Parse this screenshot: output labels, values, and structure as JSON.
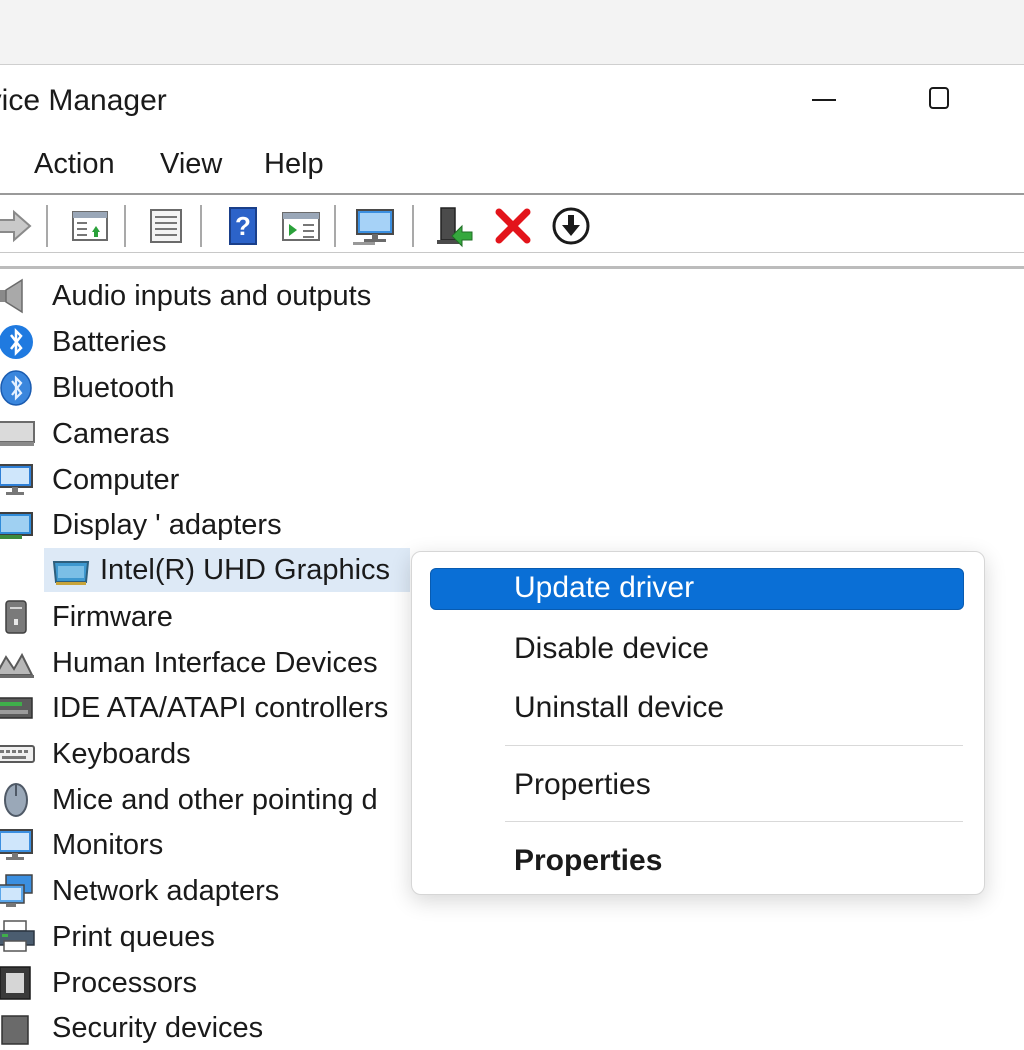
{
  "window": {
    "title": "evice Manager"
  },
  "menubar": {
    "items": [
      {
        "label": "Action"
      },
      {
        "label": "View"
      },
      {
        "label": "Help"
      }
    ]
  },
  "toolbar": {
    "buttons": [
      {
        "icon": "forward-arrow-icon"
      },
      {
        "icon": "properties-pane-icon"
      },
      {
        "icon": "details-list-icon"
      },
      {
        "icon": "help-icon"
      },
      {
        "icon": "show-hidden-icon"
      },
      {
        "icon": "scan-hardware-monitor-icon"
      },
      {
        "icon": "update-driver-icon"
      },
      {
        "icon": "uninstall-x-icon"
      },
      {
        "icon": "disable-device-icon"
      }
    ]
  },
  "tree": {
    "items": [
      {
        "label": "Audio inputs and outputs",
        "icon": "speaker-icon"
      },
      {
        "label": "Batteries",
        "icon": "bluetooth-badge-icon"
      },
      {
        "label": "Bluetooth",
        "icon": "bluetooth-icon"
      },
      {
        "label": "Cameras",
        "icon": "camera-icon"
      },
      {
        "label": "Computer",
        "icon": "computer-icon"
      },
      {
        "label": "Display ' adapters",
        "icon": "display-adapter-icon"
      },
      {
        "label": "Intel(R) UHD Graphics",
        "icon": "graphics-card-icon",
        "selected": true
      },
      {
        "label": "Firmware",
        "icon": "firmware-icon"
      },
      {
        "label": "Human Interface Devices",
        "icon": "hid-icon"
      },
      {
        "label": "IDE ATA/ATAPI controllers",
        "icon": "ide-controller-icon"
      },
      {
        "label": "Keyboards",
        "icon": "keyboard-icon"
      },
      {
        "label": "Mice and other pointing d",
        "icon": "mouse-icon"
      },
      {
        "label": "Monitors",
        "icon": "monitor-icon"
      },
      {
        "label": "Network adapters",
        "icon": "network-adapter-icon"
      },
      {
        "label": "Print queues",
        "icon": "printer-icon"
      },
      {
        "label": "Processors",
        "icon": "processor-icon"
      },
      {
        "label": "Security devices",
        "icon": "security-device-icon"
      }
    ]
  },
  "context_menu": {
    "items": [
      {
        "label": "Update driver",
        "highlighted": true
      },
      {
        "label": "Disable device"
      },
      {
        "label": "Uninstall device"
      },
      {
        "label": "Properties"
      },
      {
        "label": "Properties",
        "bold": true
      }
    ]
  },
  "colors": {
    "highlight": "#0a6fd6",
    "selection_row": "#dde9f6",
    "uninstall_red": "#e3141b"
  }
}
